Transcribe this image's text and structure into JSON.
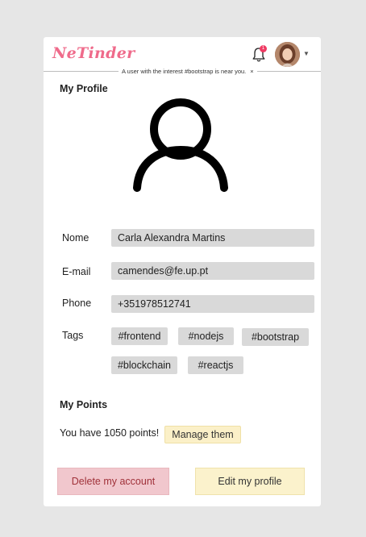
{
  "header": {
    "logo": "NeTinder",
    "notification_count": "1",
    "toast": {
      "message": "A user with the interest #bootstrap is near you.",
      "close": "×"
    }
  },
  "profile": {
    "title": "My Profile",
    "fields": {
      "name_label": "Nome",
      "name_value": "Carla Alexandra Martins",
      "email_label": "E-mail",
      "email_value": "camendes@fe.up.pt",
      "phone_label": "Phone",
      "phone_value": "+351978512741",
      "tags_label": "Tags"
    },
    "tags": [
      "#frontend",
      "#nodejs",
      "#bootstrap",
      "#blockchain",
      "#reactjs"
    ]
  },
  "points": {
    "title": "My Points",
    "text": "You have 1050 points!",
    "manage_label": "Manage them"
  },
  "actions": {
    "delete_label": "Delete my account",
    "edit_label": "Edit my profile"
  },
  "colors": {
    "logo": "#ef6b8b",
    "badge": "#ef3b63",
    "field_bg": "#d9d9d9",
    "delete_bg": "#f1c7cd",
    "edit_bg": "#fbf2cc"
  }
}
